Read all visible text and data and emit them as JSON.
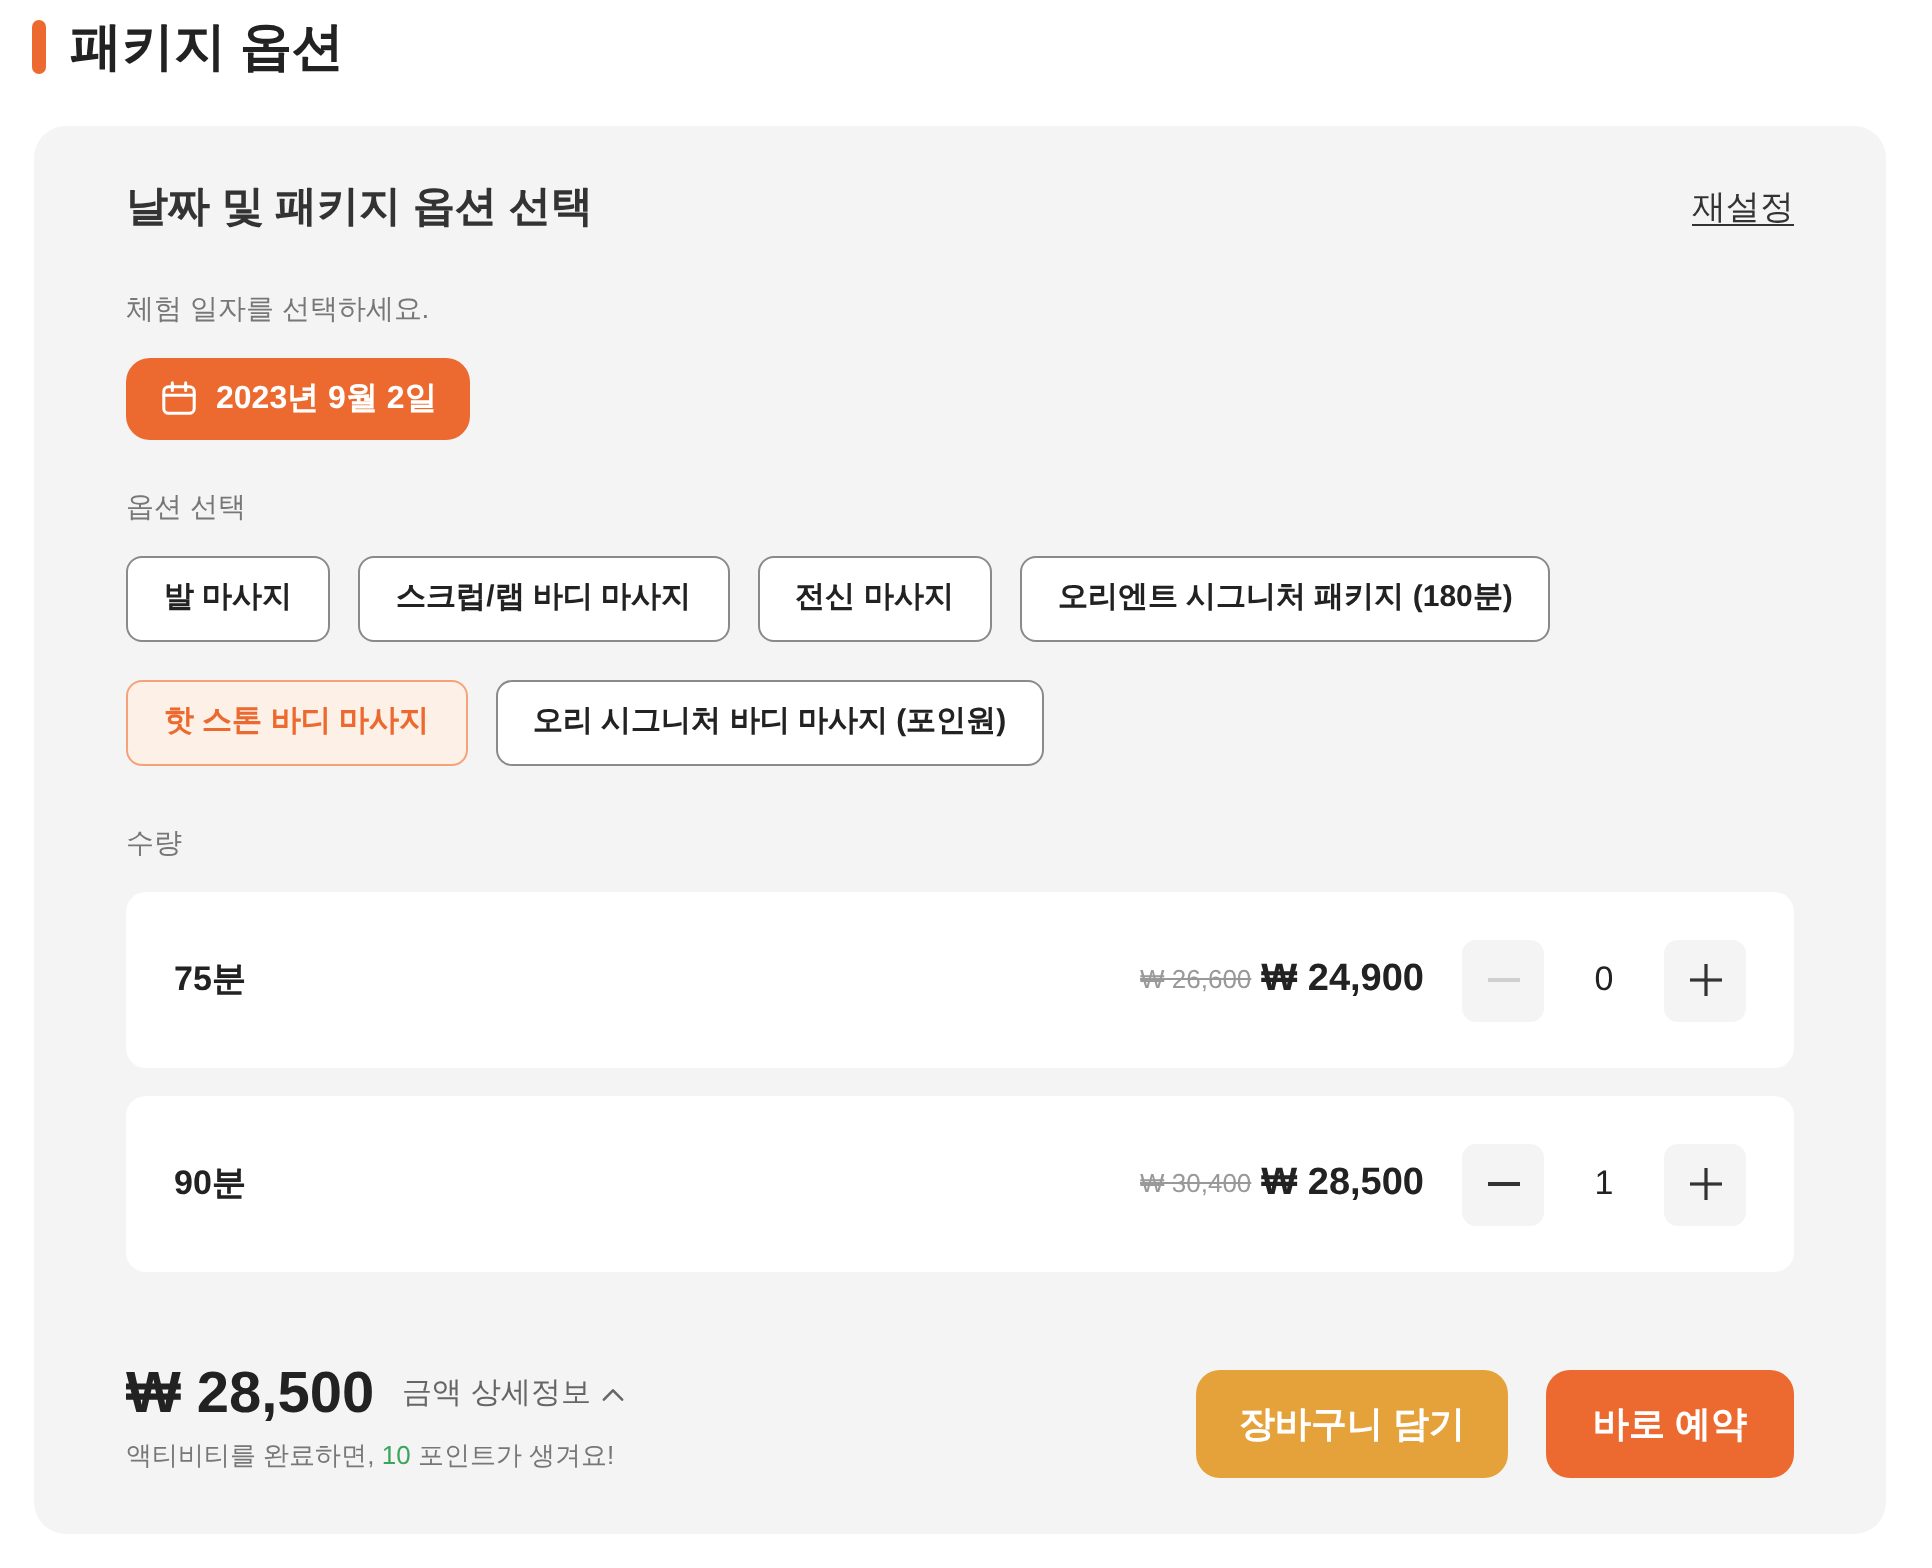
{
  "page_title": "패키지 옵션",
  "panel": {
    "title": "날짜 및 패키지 옵션 선택",
    "reset_link": "재설정"
  },
  "date": {
    "label": "체험 일자를 선택하세요.",
    "value": "2023년 9월 2일"
  },
  "options": {
    "label": "옵션 선택",
    "items": [
      {
        "label": "발 마사지",
        "selected": false
      },
      {
        "label": "스크럽/랩 바디 마사지",
        "selected": false
      },
      {
        "label": "전신 마사지",
        "selected": false
      },
      {
        "label": "오리엔트 시그니처 패키지 (180분)",
        "selected": false
      },
      {
        "label": "핫 스톤 바디 마사지",
        "selected": true
      },
      {
        "label": "오리 시그니처 바디 마사지 (포인원)",
        "selected": false
      }
    ]
  },
  "quantity": {
    "label": "수량",
    "rows": [
      {
        "name": "75분",
        "original_price": "₩ 26,600",
        "price": "₩ 24,900",
        "count": "0",
        "decrease_disabled": true
      },
      {
        "name": "90분",
        "original_price": "₩ 30,400",
        "price": "₩ 28,500",
        "count": "1",
        "decrease_disabled": false
      }
    ]
  },
  "summary": {
    "total": "₩ 28,500",
    "details_toggle": "금액 상세정보",
    "points_note": {
      "before": "액티비티를 완료하면,",
      "points": "10",
      "after": "포인트가 생겨요!"
    }
  },
  "buttons": [
    {
      "label": "장바구니 담기",
      "kind": "secondary"
    },
    {
      "label": "바로 예약",
      "kind": "primary"
    }
  ]
}
